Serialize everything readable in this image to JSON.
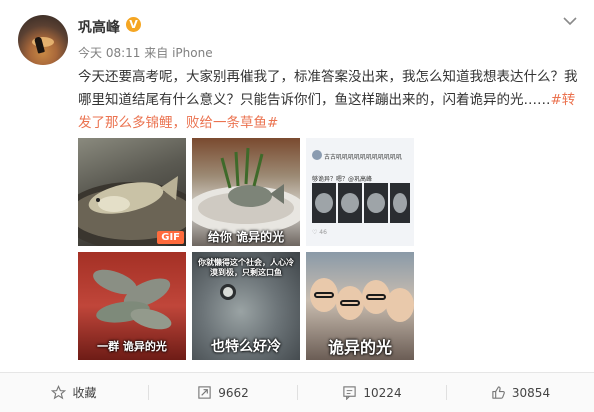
{
  "post": {
    "username": "巩高峰",
    "vip_mark": "V",
    "time": "今天 08:11",
    "source_prefix": "来自",
    "source": "iPhone",
    "text_main": "今天还要高考呢，大家别再催我了，标准答案没出来，我怎么知道我想表达什么？我哪里知道结尾有什么意义？只能告诉你们，鱼这样蹦出来的，闪着诡异的光……",
    "topic_1": "#转发了那么多锦鲤，败给一条草鱼#"
  },
  "images": {
    "gif_badge": "GIF",
    "caption_2": "给你  诡异的光",
    "caption_4": "一群 诡异的光",
    "caption_5_top": "你就懒得这个社会，人心冷漠到极，只剩这口鱼",
    "caption_5": "也特么好冷",
    "caption_6": "诡异的光",
    "mini_title": "古古叽叽叽叽叽叽叽叽叽叽叽",
    "mini_sub": "够诡异？嗯？@巩高峰",
    "mini_foot": "♡ 46"
  },
  "actions": {
    "favorite_label": "收藏",
    "repost_count": "9662",
    "comment_count": "10224",
    "like_count": "30854"
  },
  "colors": {
    "topic": "#eb7350",
    "vip": "#f5a623",
    "gif_badge": "#ff6b3d"
  }
}
